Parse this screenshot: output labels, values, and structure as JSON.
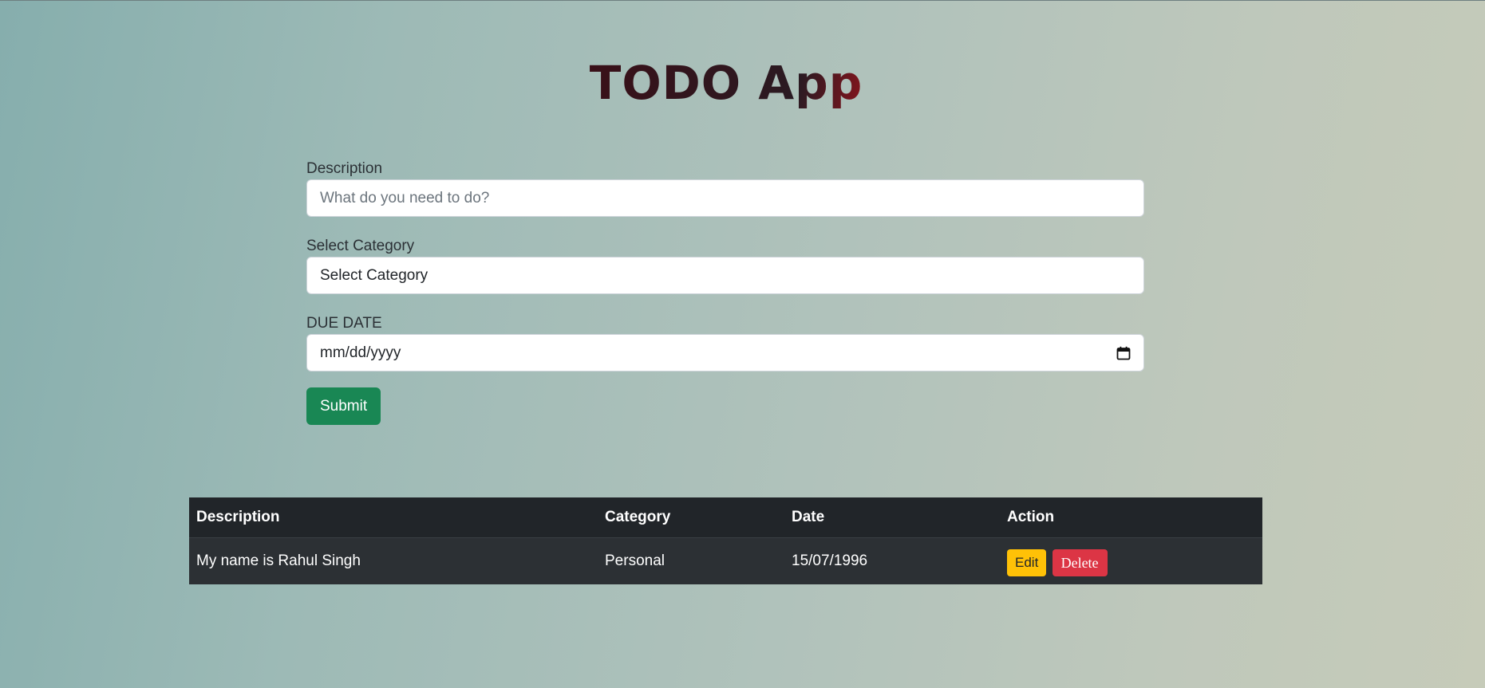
{
  "app": {
    "title": "TODO App"
  },
  "form": {
    "description": {
      "label": "Description",
      "placeholder": "What do you need to do?"
    },
    "category": {
      "label": "Select Category",
      "selected": "Select Category"
    },
    "due_date": {
      "label": "DUE DATE",
      "placeholder": "mm/dd/yyyy",
      "icon": "calendar-icon"
    },
    "submit_label": "Submit"
  },
  "table": {
    "headers": [
      "Description",
      "Category",
      "Date",
      "Action"
    ],
    "rows": [
      {
        "description": "My name is Rahul Singh",
        "category": "Personal",
        "date": "15/07/1996",
        "edit_label": "Edit",
        "delete_label": "Delete"
      }
    ]
  },
  "colors": {
    "submit": "#198754",
    "edit": "#ffc107",
    "delete": "#dc3545",
    "table_dark": "#212529"
  }
}
